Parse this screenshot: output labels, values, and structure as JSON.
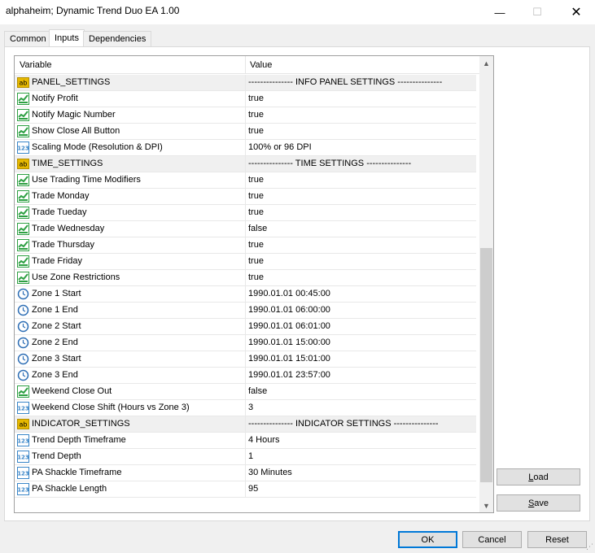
{
  "window": {
    "title": "alphaheim; Dynamic Trend Duo EA 1.00",
    "minimize": "—",
    "maximize": "☐",
    "close": "✕"
  },
  "tabs": [
    "Common",
    "Inputs",
    "Dependencies"
  ],
  "active_tab": "Inputs",
  "grid": {
    "header_variable": "Variable",
    "header_value": "Value",
    "rows": [
      {
        "icon": "string-icon",
        "name": "PANEL_SETTINGS",
        "value": "--------------- INFO PANEL SETTINGS ---------------",
        "group": true
      },
      {
        "icon": "bool-icon",
        "name": "Notify Profit",
        "value": "true"
      },
      {
        "icon": "bool-icon",
        "name": "Notify Magic Number",
        "value": "true"
      },
      {
        "icon": "bool-icon",
        "name": "Show Close All Button",
        "value": "true"
      },
      {
        "icon": "number-icon",
        "name": "Scaling Mode (Resolution & DPI)",
        "value": "100% or 96 DPI"
      },
      {
        "icon": "string-icon",
        "name": "TIME_SETTINGS",
        "value": "--------------- TIME SETTINGS ---------------",
        "group": true
      },
      {
        "icon": "bool-icon",
        "name": "Use Trading Time Modifiers",
        "value": "true"
      },
      {
        "icon": "bool-icon",
        "name": "Trade Monday",
        "value": "true"
      },
      {
        "icon": "bool-icon",
        "name": "Trade Tueday",
        "value": "true"
      },
      {
        "icon": "bool-icon",
        "name": "Trade Wednesday",
        "value": "false"
      },
      {
        "icon": "bool-icon",
        "name": "Trade Thursday",
        "value": "true"
      },
      {
        "icon": "bool-icon",
        "name": "Trade Friday",
        "value": "true"
      },
      {
        "icon": "bool-icon",
        "name": "Use Zone Restrictions",
        "value": "true"
      },
      {
        "icon": "clock-icon",
        "name": "Zone 1 Start",
        "value": "1990.01.01 00:45:00"
      },
      {
        "icon": "clock-icon",
        "name": "Zone 1 End",
        "value": "1990.01.01 06:00:00"
      },
      {
        "icon": "clock-icon",
        "name": "Zone 2 Start",
        "value": "1990.01.01 06:01:00"
      },
      {
        "icon": "clock-icon",
        "name": "Zone 2 End",
        "value": "1990.01.01 15:00:00"
      },
      {
        "icon": "clock-icon",
        "name": "Zone 3 Start",
        "value": "1990.01.01 15:01:00"
      },
      {
        "icon": "clock-icon",
        "name": "Zone 3 End",
        "value": "1990.01.01 23:57:00"
      },
      {
        "icon": "bool-icon",
        "name": "Weekend Close Out",
        "value": "false"
      },
      {
        "icon": "number-icon",
        "name": "Weekend Close Shift (Hours vs Zone 3)",
        "value": "3"
      },
      {
        "icon": "string-icon",
        "name": "INDICATOR_SETTINGS",
        "value": "--------------- INDICATOR SETTINGS ---------------",
        "group": true
      },
      {
        "icon": "number-icon",
        "name": "Trend Depth Timeframe",
        "value": "4 Hours"
      },
      {
        "icon": "number-icon",
        "name": "Trend Depth",
        "value": "1"
      },
      {
        "icon": "number-icon",
        "name": "PA Shackle Timeframe",
        "value": "30 Minutes"
      },
      {
        "icon": "number-icon",
        "name": "PA Shackle Length",
        "value": "95"
      }
    ]
  },
  "buttons": {
    "load_first": "L",
    "load_rest": "oad",
    "save_first": "S",
    "save_rest": "ave",
    "ok": "OK",
    "cancel": "Cancel",
    "reset": "Reset"
  },
  "colors": {
    "ok_border": "#0078d7",
    "bool_icon": "#2ea043",
    "string_icon": "#e6b800",
    "number_icon": "#3a86c8",
    "clock_icon": "#2f6fb5"
  }
}
